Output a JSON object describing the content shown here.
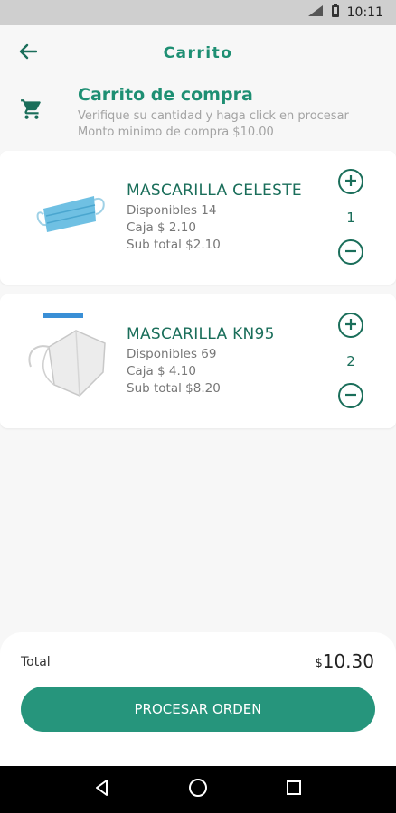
{
  "status_bar": {
    "time": "10:11"
  },
  "app_bar": {
    "title": "Carrito"
  },
  "cart_header": {
    "title": "Carrito de compra",
    "subtitle_line1": "Verifique su cantidad y haga click en procesar",
    "subtitle_line2": "Monto minimo de compra $10.00"
  },
  "items": [
    {
      "name": "MASCARILLA CELESTE",
      "disponibles": "Disponibles 14",
      "caja": "Caja $ 2.10",
      "subtotal": "Sub total  $2.10",
      "quantity": "1",
      "image": "blue-surgical-mask"
    },
    {
      "name": "MASCARILLA KN95",
      "disponibles": "Disponibles 69",
      "caja": "Caja $ 4.10",
      "subtotal": "Sub total  $8.20",
      "quantity": "2",
      "image": "white-kn95-mask"
    }
  ],
  "footer": {
    "total_label": "Total",
    "total_currency": "$",
    "total_value": "10.30",
    "checkout_label": "PROCESAR ORDEN"
  },
  "icons": {
    "back": "arrow-left-icon",
    "cart": "shopping-cart-icon",
    "plus": "plus-circle-icon",
    "minus": "minus-circle-icon",
    "nav_back": "triangle-back-icon",
    "nav_home": "circle-home-icon",
    "nav_recents": "square-recents-icon"
  },
  "colors": {
    "accent": "#1e8f73",
    "button": "#26957c",
    "dark_green": "#1a6e5a"
  }
}
